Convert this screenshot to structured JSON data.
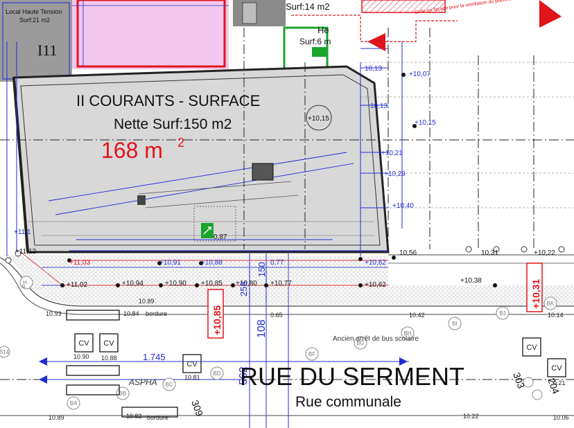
{
  "colors": {
    "blue": "#1f2bd6",
    "red": "#e0141b",
    "green": "#1aa52c",
    "pink": "#f3c7ee",
    "room_gray": "#d8d8d8",
    "dark_gray": "#9b9b9b",
    "sidewalk": "#ececec"
  },
  "rooms": {
    "local_ht": {
      "line1": "Local Haute Tension",
      "line2": "Surf:21 m2",
      "number": "I11"
    },
    "top_surf": "Surf:14 m2",
    "he_label": "He",
    "surf6": "Surf:6 m",
    "courants": {
      "title": "II  COURANTS - SURFACE",
      "net": "Nette Surf:150 m2",
      "gross": "168 m",
      "gross_exp": "2"
    }
  },
  "notes": {
    "grille": "Grille en façade pour la\nventilation du plancher"
  },
  "levels": {
    "l1013a": "10,13",
    "l1007": "+10,07",
    "l1013b": "10,13",
    "l1015a": "+10,15",
    "l1015b": "+10,15",
    "l1021": "+10,21",
    "l1029": "+10,29",
    "l1040": "+10,40",
    "l1011": "+11,1",
    "l087": "0,87",
    "l1056": "10,56",
    "l1031": "10,31",
    "l1022": "+10,22",
    "l1103": "+11,03",
    "l1091": "+10,91",
    "l1088": "+10,88",
    "l1077a": "0,77",
    "l1062a": "+10,62",
    "l1102": "+11,02",
    "l1094": "+10,94",
    "l1090": "+10,90",
    "l1085": "+10,85",
    "l1080": "+10,80",
    "l1077b": "+10,77",
    "l1062b": "+10,62",
    "l1038": "+10,38",
    "l11b": "+11,12"
  },
  "red_boxes": {
    "left": "+10,85",
    "right": "+10,31"
  },
  "dims": {
    "d1745": "1.745",
    "d562": "562",
    "d108": "108",
    "d150": "150",
    "d258": "258"
  },
  "street": {
    "name": "RUE DU SERMENT",
    "sub": "Rue communale",
    "ancien": "Ancien arrêt de bus scolaire",
    "asph": "ASPHA"
  },
  "terrain": {
    "t1089": "10.89",
    "t1093": "10.93",
    "t1084": "10.84",
    "bordure1": "bordure",
    "t1090": "10.90",
    "t1088": "10.88",
    "t1042": "10.42",
    "t1014": "10.14",
    "t1065": "0.65",
    "t1081": "10.81",
    "t1089b": "10.89",
    "t1082": "10.82",
    "bordure2": "bordure",
    "t1022": "10.22",
    "t1006": "10.06",
    "t021": "0.21"
  },
  "points": {
    "BD": "BD",
    "BC": "BC",
    "BB": "BB",
    "BA": "BA",
    "BF": "BF",
    "BG": "BG",
    "BH": "BH",
    "BI": "BI",
    "BJ": "BJ",
    "BK": "BK",
    "PS": "PS",
    "B14": "B14"
  },
  "cv": {
    "cv1": "CV",
    "cv2": "CV",
    "cv3": "CV",
    "cv4": "CV",
    "cv5": "CV"
  },
  "rotated": {
    "r309": "309",
    "r303": "303",
    "r204": "204"
  }
}
